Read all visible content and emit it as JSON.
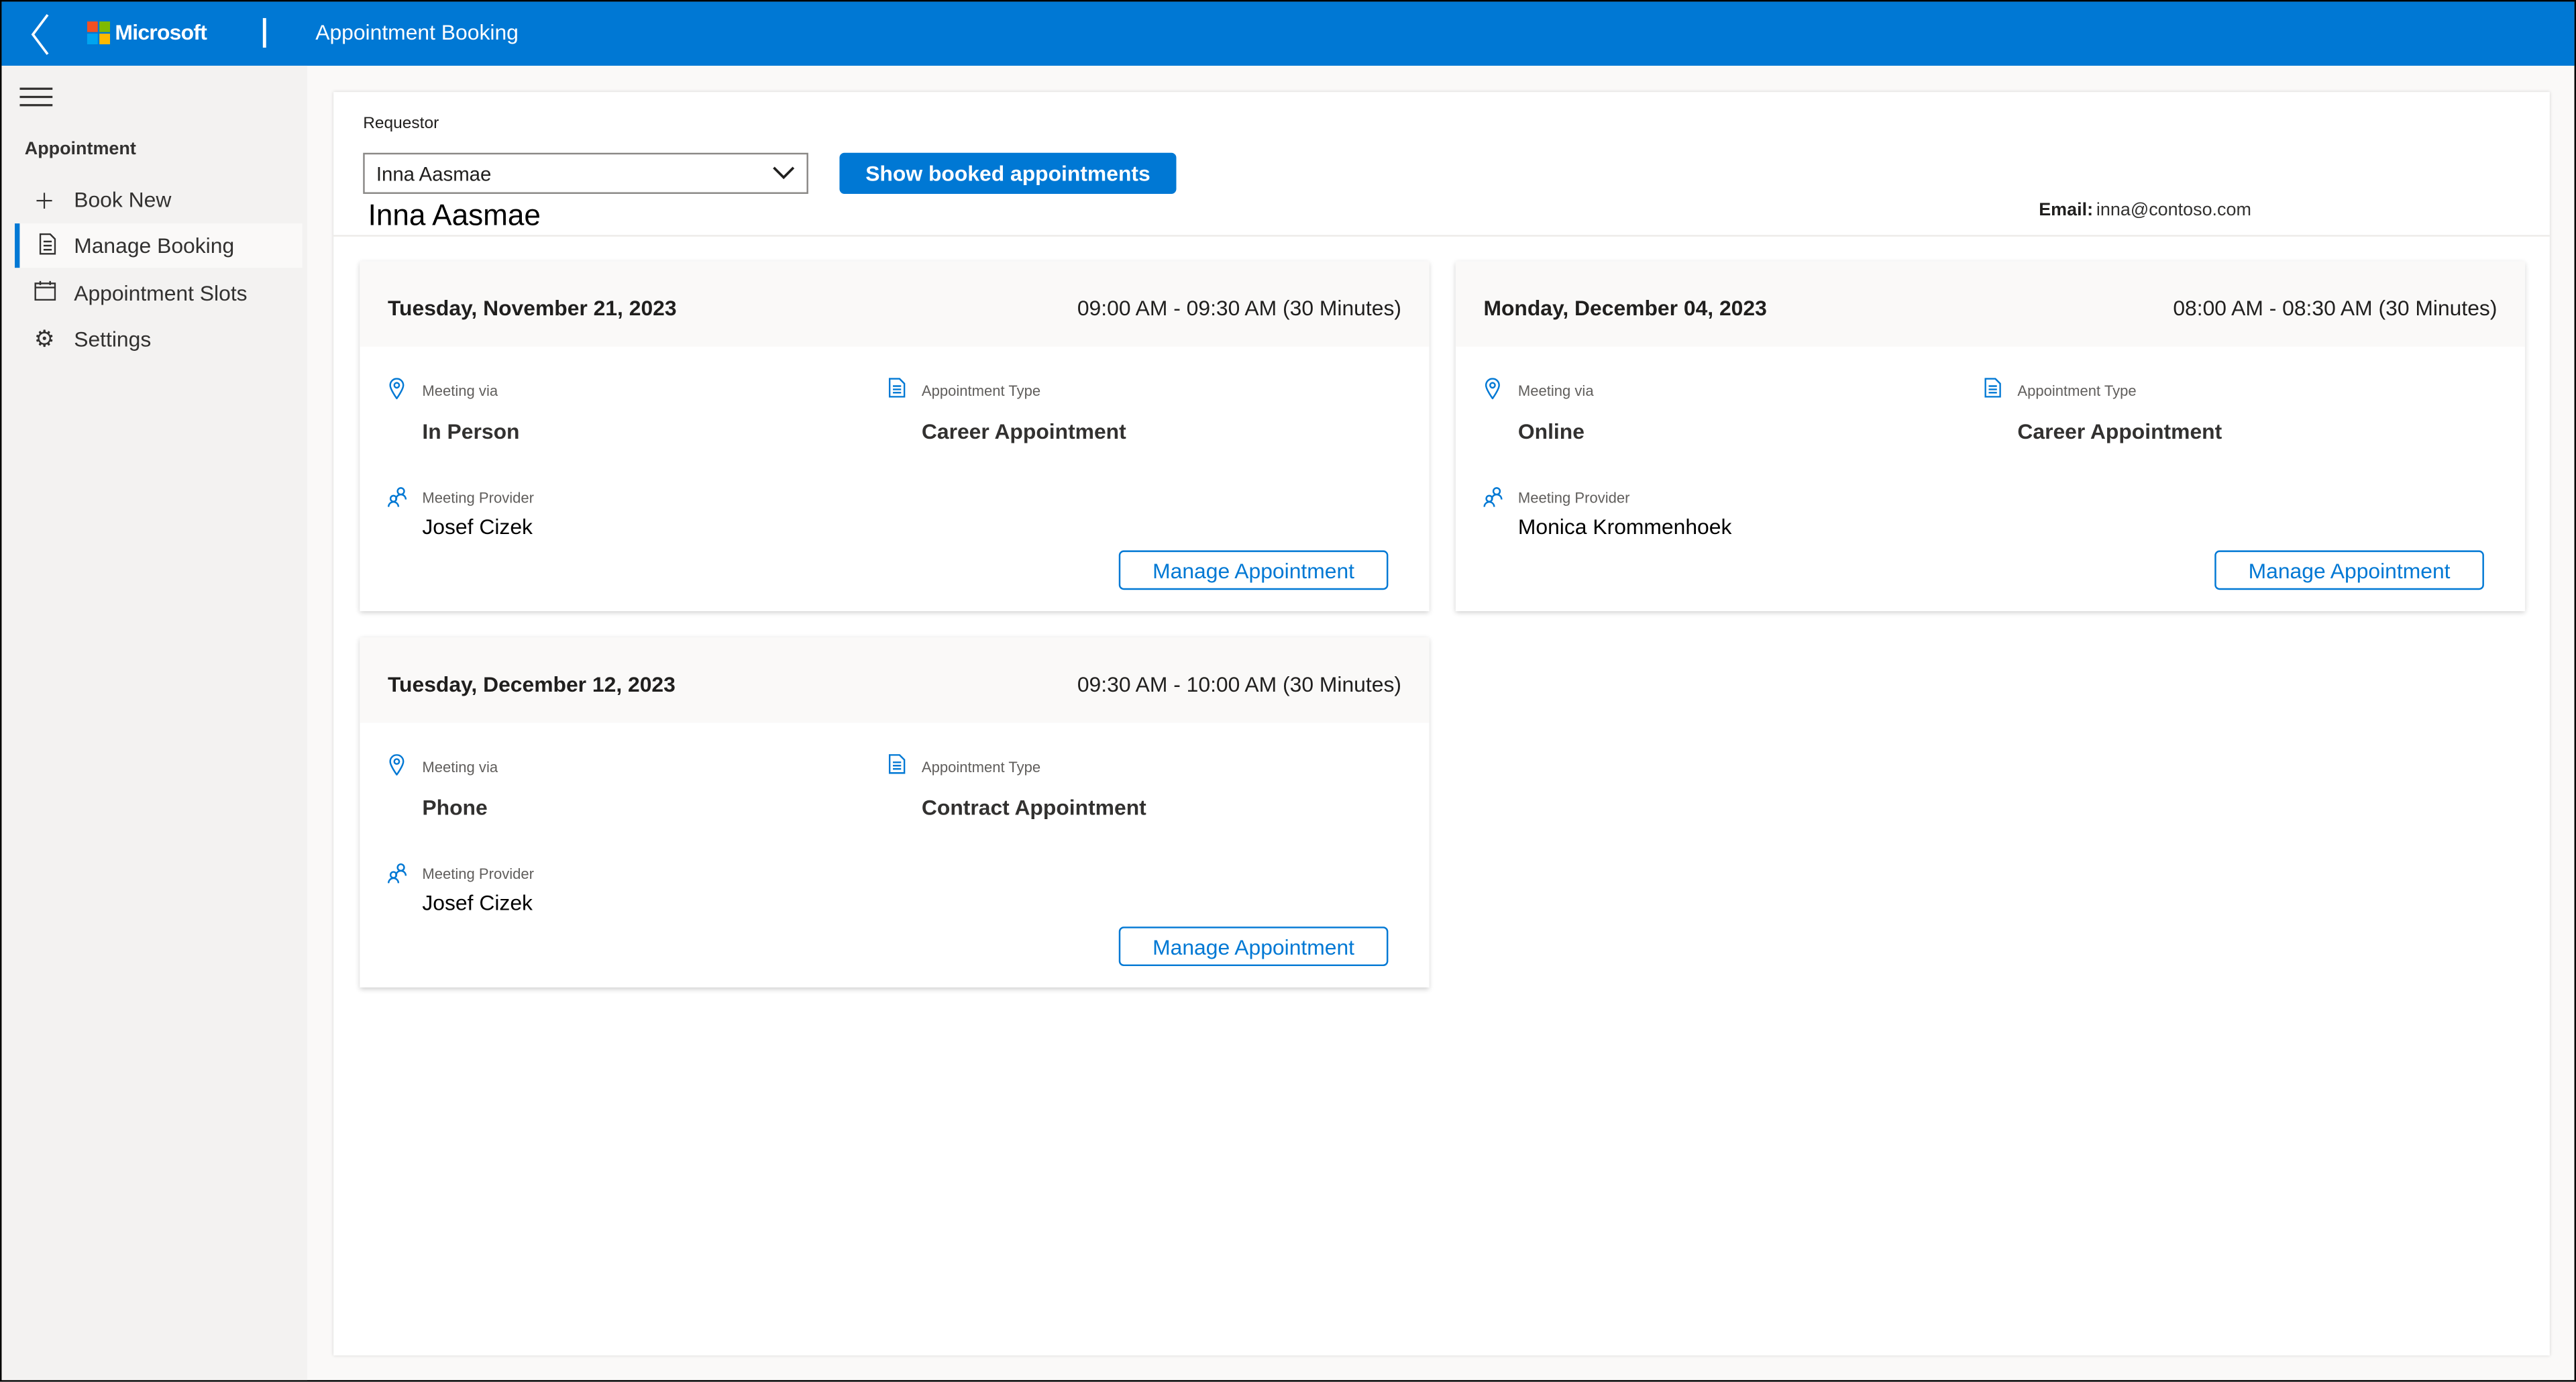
{
  "header": {
    "brand": "Microsoft",
    "title": "Appointment Booking",
    "color": "#0078d4"
  },
  "sidebar": {
    "section": "Appointment",
    "items": [
      {
        "label": "Book New",
        "icon": "plus-icon"
      },
      {
        "label": "Manage Booking",
        "icon": "document-icon",
        "selected": true
      },
      {
        "label": "Appointment Slots",
        "icon": "calendar-icon"
      },
      {
        "label": "Settings",
        "icon": "gear-icon"
      }
    ]
  },
  "requestor": {
    "label": "Requestor",
    "value": "Inna Aasmae",
    "show_button": "Show booked appointments",
    "name": "Inna Aasmae",
    "email_label": "Email:",
    "email": "inna@contoso.com"
  },
  "cards": [
    {
      "date": "Tuesday, November 21, 2023",
      "time": "09:00 AM - 09:30 AM (30 Minutes)",
      "via_label": "Meeting via",
      "via": "In Person",
      "type_label": "Appointment Type",
      "type": "Career Appointment",
      "provider_label": "Meeting Provider",
      "provider": "Josef Cizek",
      "button": "Manage Appointment"
    },
    {
      "date": "Monday, December 04, 2023",
      "time": "08:00 AM - 08:30 AM (30 Minutes)",
      "via_label": "Meeting via",
      "via": "Online",
      "type_label": "Appointment Type",
      "type": "Career Appointment",
      "provider_label": "Meeting Provider",
      "provider": "Monica Krommenhoek",
      "button": "Manage Appointment"
    },
    {
      "date": "Tuesday, December 12, 2023",
      "time": "09:30 AM - 10:00 AM (30 Minutes)",
      "via_label": "Meeting via",
      "via": "Phone",
      "type_label": "Appointment Type",
      "type": "Contract Appointment",
      "provider_label": "Meeting Provider",
      "provider": "Josef Cizek",
      "button": "Manage Appointment"
    }
  ]
}
